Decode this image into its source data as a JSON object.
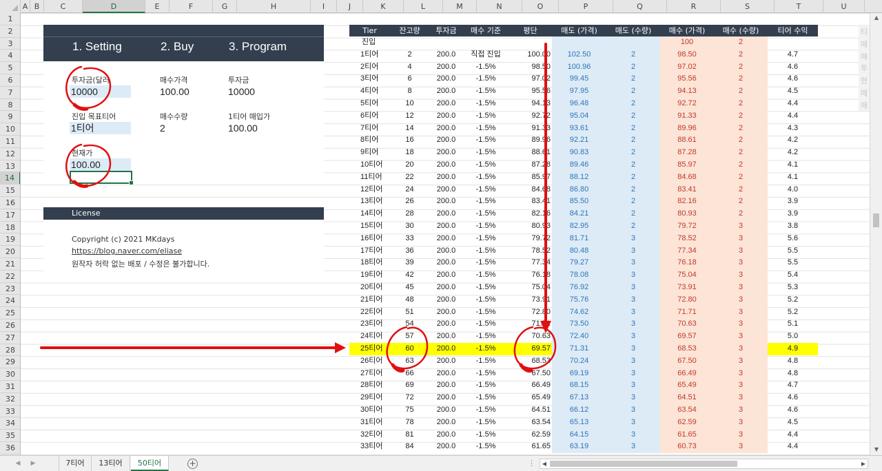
{
  "columns": [
    "A",
    "B",
    "C",
    "D",
    "E",
    "F",
    "G",
    "H",
    "I",
    "J",
    "K",
    "L",
    "M",
    "N",
    "O",
    "P",
    "Q",
    "R",
    "S",
    "T",
    "U"
  ],
  "selected_column": "D",
  "selected_row": "14",
  "rows": [
    "1",
    "2",
    "3",
    "4",
    "5",
    "6",
    "7",
    "8",
    "9",
    "10",
    "11",
    "12",
    "13",
    "14",
    "15",
    "16",
    "17",
    "18",
    "19",
    "20",
    "21",
    "22",
    "23",
    "24",
    "25",
    "26",
    "27",
    "28",
    "29",
    "30",
    "31",
    "32",
    "33",
    "34",
    "35",
    "36"
  ],
  "panel1": {
    "steps": [
      "1. Setting",
      "2. Buy",
      "3. Program"
    ],
    "investment_label": "투자금(달러",
    "investment_value": "10000",
    "buy_price_label": "매수가격",
    "buy_price_value": "100.00",
    "invest_label2": "투자금",
    "invest_value2": "10000",
    "target_tier_label": "진입 목표티어",
    "target_tier_value": "1티어",
    "buy_qty_label": "매수수량",
    "buy_qty_value": "2",
    "tier1_price_label": "1티어 매입가",
    "tier1_price_value": "100.00",
    "current_price_label": "현재가",
    "current_price_value": "100.00"
  },
  "license": {
    "title": "License",
    "copyright": "Copyright (c) 2021 MKdays",
    "link": "https://blog.naver.com/eliase",
    "notice": "원작자 허락 없는 배포 / 수정은 불가합니다."
  },
  "table": {
    "headers": [
      "Tier",
      "잔고량",
      "투자금",
      "매수 기준",
      "평단",
      "매도 (가격)",
      "매도 (수량)",
      "매수 (가격)",
      "매수 (수량)",
      "티어 수익"
    ],
    "entry_row": {
      "tier": "진입",
      "buy_price": "100",
      "buy_qty": "2"
    },
    "highlight_index": 24,
    "rows": [
      [
        "1티어",
        "2",
        "200.0",
        "직접 진입",
        "100.00",
        "102.50",
        "2",
        "98.50",
        "2",
        "4.7"
      ],
      [
        "2티어",
        "4",
        "200.0",
        "-1.5%",
        "98.50",
        "100.96",
        "2",
        "97.02",
        "2",
        "4.6"
      ],
      [
        "3티어",
        "6",
        "200.0",
        "-1.5%",
        "97.02",
        "99.45",
        "2",
        "95.56",
        "2",
        "4.6"
      ],
      [
        "4티어",
        "8",
        "200.0",
        "-1.5%",
        "95.56",
        "97.95",
        "2",
        "94.13",
        "2",
        "4.5"
      ],
      [
        "5티어",
        "10",
        "200.0",
        "-1.5%",
        "94.13",
        "96.48",
        "2",
        "92.72",
        "2",
        "4.4"
      ],
      [
        "6티어",
        "12",
        "200.0",
        "-1.5%",
        "92.72",
        "95.04",
        "2",
        "91.33",
        "2",
        "4.4"
      ],
      [
        "7티어",
        "14",
        "200.0",
        "-1.5%",
        "91.33",
        "93.61",
        "2",
        "89.96",
        "2",
        "4.3"
      ],
      [
        "8티어",
        "16",
        "200.0",
        "-1.5%",
        "89.96",
        "92.21",
        "2",
        "88.61",
        "2",
        "4.2"
      ],
      [
        "9티어",
        "18",
        "200.0",
        "-1.5%",
        "88.61",
        "90.83",
        "2",
        "87.28",
        "2",
        "4.2"
      ],
      [
        "10티어",
        "20",
        "200.0",
        "-1.5%",
        "87.28",
        "89.46",
        "2",
        "85.97",
        "2",
        "4.1"
      ],
      [
        "11티어",
        "22",
        "200.0",
        "-1.5%",
        "85.97",
        "88.12",
        "2",
        "84.68",
        "2",
        "4.1"
      ],
      [
        "12티어",
        "24",
        "200.0",
        "-1.5%",
        "84.68",
        "86.80",
        "2",
        "83.41",
        "2",
        "4.0"
      ],
      [
        "13티어",
        "26",
        "200.0",
        "-1.5%",
        "83.41",
        "85.50",
        "2",
        "82.16",
        "2",
        "3.9"
      ],
      [
        "14티어",
        "28",
        "200.0",
        "-1.5%",
        "82.16",
        "84.21",
        "2",
        "80.93",
        "2",
        "3.9"
      ],
      [
        "15티어",
        "30",
        "200.0",
        "-1.5%",
        "80.93",
        "82.95",
        "2",
        "79.72",
        "3",
        "3.8"
      ],
      [
        "16티어",
        "33",
        "200.0",
        "-1.5%",
        "79.72",
        "81.71",
        "3",
        "78.52",
        "3",
        "5.6"
      ],
      [
        "17티어",
        "36",
        "200.0",
        "-1.5%",
        "78.52",
        "80.48",
        "3",
        "77.34",
        "3",
        "5.5"
      ],
      [
        "18티어",
        "39",
        "200.0",
        "-1.5%",
        "77.34",
        "79.27",
        "3",
        "76.18",
        "3",
        "5.5"
      ],
      [
        "19티어",
        "42",
        "200.0",
        "-1.5%",
        "76.18",
        "78.08",
        "3",
        "75.04",
        "3",
        "5.4"
      ],
      [
        "20티어",
        "45",
        "200.0",
        "-1.5%",
        "75.04",
        "76.92",
        "3",
        "73.91",
        "3",
        "5.3"
      ],
      [
        "21티어",
        "48",
        "200.0",
        "-1.5%",
        "73.91",
        "75.76",
        "3",
        "72.80",
        "3",
        "5.2"
      ],
      [
        "22티어",
        "51",
        "200.0",
        "-1.5%",
        "72.80",
        "74.62",
        "3",
        "71.71",
        "3",
        "5.2"
      ],
      [
        "23티어",
        "54",
        "200.0",
        "-1.5%",
        "71.71",
        "73.50",
        "3",
        "70.63",
        "3",
        "5.1"
      ],
      [
        "24티어",
        "57",
        "200.0",
        "-1.5%",
        "70.63",
        "72.40",
        "3",
        "69.57",
        "3",
        "5.0"
      ],
      [
        "25티어",
        "60",
        "200.0",
        "-1.5%",
        "69.57",
        "71.31",
        "3",
        "68.53",
        "3",
        "4.9"
      ],
      [
        "26티어",
        "63",
        "200.0",
        "-1.5%",
        "68.53",
        "70.24",
        "3",
        "67.50",
        "3",
        "4.8"
      ],
      [
        "27티어",
        "66",
        "200.0",
        "-1.5%",
        "67.50",
        "69.19",
        "3",
        "66.49",
        "3",
        "4.8"
      ],
      [
        "28티어",
        "69",
        "200.0",
        "-1.5%",
        "66.49",
        "68.15",
        "3",
        "65.49",
        "3",
        "4.7"
      ],
      [
        "29티어",
        "72",
        "200.0",
        "-1.5%",
        "65.49",
        "67.13",
        "3",
        "64.51",
        "3",
        "4.6"
      ],
      [
        "30티어",
        "75",
        "200.0",
        "-1.5%",
        "64.51",
        "66.12",
        "3",
        "63.54",
        "3",
        "4.6"
      ],
      [
        "31티어",
        "78",
        "200.0",
        "-1.5%",
        "63.54",
        "65.13",
        "3",
        "62.59",
        "3",
        "4.5"
      ],
      [
        "32티어",
        "81",
        "200.0",
        "-1.5%",
        "62.59",
        "64.15",
        "3",
        "61.65",
        "3",
        "4.4"
      ],
      [
        "33티어",
        "84",
        "200.0",
        "-1.5%",
        "61.65",
        "63.19",
        "3",
        "60.73",
        "3",
        "4.4"
      ]
    ]
  },
  "right_partial": [
    "티",
    "매",
    "매",
    "투",
    "현",
    "매",
    "매"
  ],
  "sheet_tabs": [
    "7티어",
    "13티어",
    "50티어"
  ],
  "active_tab": "50티어",
  "accent_color": "#217346",
  "header_color": "#333f4f",
  "highlight_color": "#ffff00",
  "annotation_color": "#e01010"
}
